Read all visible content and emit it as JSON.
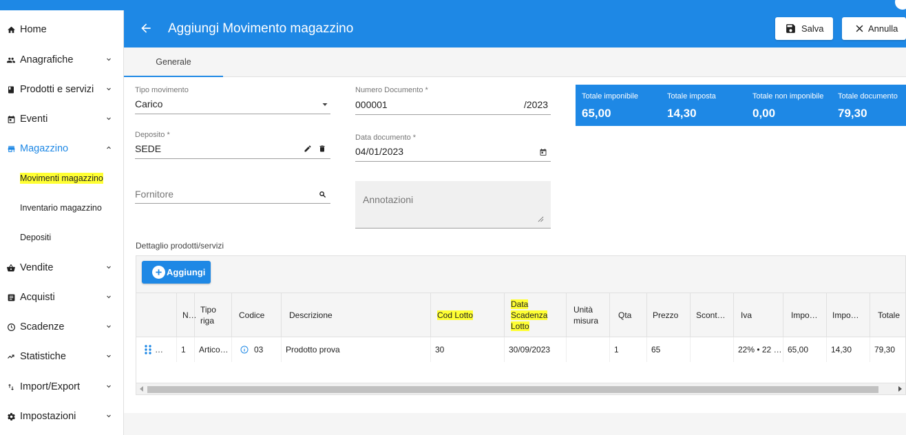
{
  "sidebar": {
    "items": [
      {
        "label": "Home",
        "icon": "home-icon"
      },
      {
        "label": "Anagrafiche",
        "icon": "people-icon"
      },
      {
        "label": "Prodotti e servizi",
        "icon": "book-icon"
      },
      {
        "label": "Eventi",
        "icon": "calendar-icon"
      },
      {
        "label": "Magazzino",
        "icon": "warehouse-icon"
      },
      {
        "label": "Vendite",
        "icon": "basket-icon"
      },
      {
        "label": "Acquisti",
        "icon": "list-icon"
      },
      {
        "label": "Scadenze",
        "icon": "clock-icon"
      },
      {
        "label": "Statistiche",
        "icon": "trending-icon"
      },
      {
        "label": "Import/Export",
        "icon": "swap-icon"
      },
      {
        "label": "Impostazioni",
        "icon": "gear-icon"
      }
    ],
    "subitems": [
      "Movimenti magazzino",
      "Inventario magazzino",
      "Depositi"
    ]
  },
  "header": {
    "title": "Aggiungi Movimento magazzino",
    "save_label": "Salva",
    "cancel_label": "Annulla"
  },
  "tabs": [
    "Generale"
  ],
  "form": {
    "tipo_movimento": {
      "label": "Tipo movimento",
      "value": "Carico"
    },
    "numero_documento": {
      "label": "Numero Documento *",
      "value": "000001",
      "suffix": "/2023"
    },
    "deposito": {
      "label": "Deposito *",
      "value": "SEDE"
    },
    "data_documento": {
      "label": "Data documento *",
      "value": "04/01/2023"
    },
    "fornitore": {
      "placeholder": "Fornitore"
    },
    "annotazioni": {
      "placeholder": "Annotazioni"
    }
  },
  "totals": [
    {
      "label": "Totale imponibile",
      "value": "65,00"
    },
    {
      "label": "Totale imposta",
      "value": "14,30"
    },
    {
      "label": "Totale non imponibile",
      "value": "0,00"
    },
    {
      "label": "Totale documento",
      "value": "79,30"
    }
  ],
  "detail": {
    "section_label": "Dettaglio prodotti/servizi",
    "add_label": "Aggiungi",
    "columns": [
      "",
      "N…",
      "Tipo riga",
      "Codice",
      "Descrizione",
      "Cod Lotto",
      "Data Scadenza Lotto",
      "Unità misura",
      "Qta",
      "Prezzo",
      "Scont…",
      "Iva",
      "Impo…",
      "Impo…",
      "Totale"
    ],
    "rows": [
      [
        "…",
        "1",
        "Artico…",
        "03",
        "Prodotto prova",
        "30",
        "30/09/2023",
        "",
        "1",
        "65",
        "",
        "22% • 22 …",
        "65,00",
        "14,30",
        "79,30"
      ]
    ]
  },
  "colors": {
    "primary": "#1e88e5",
    "highlight": "#ffff33"
  }
}
